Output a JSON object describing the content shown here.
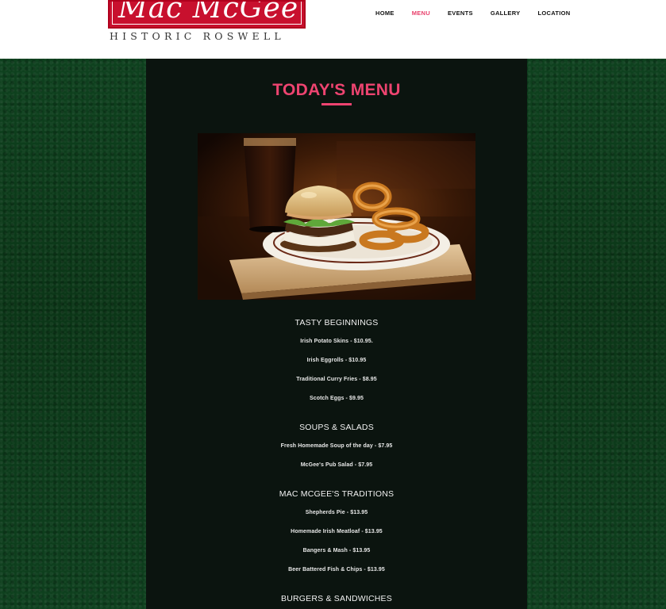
{
  "header": {
    "logo": {
      "name": "Mac McGee",
      "subtitle": "HISTORIC ROSWELL"
    },
    "nav": [
      {
        "label": "HOME",
        "active": false
      },
      {
        "label": "MENU",
        "active": true
      },
      {
        "label": "EVENTS",
        "active": false
      },
      {
        "label": "GALLERY",
        "active": false
      },
      {
        "label": "LOCATION",
        "active": false
      }
    ]
  },
  "main": {
    "title": "TODAY'S MENU",
    "sections": [
      {
        "heading": "TASTY BEGINNINGS",
        "items": [
          "Irish Potato Skins - $10.95.",
          "Irish Eggrolls - $10.95",
          "Traditional Curry Fries - $8.95",
          "Scotch Eggs - $9.95"
        ]
      },
      {
        "heading": "SOUPS & SALADS",
        "items": [
          "Fresh Homemade Soup of the day - $7.95",
          "McGee's Pub Salad - $7.95"
        ]
      },
      {
        "heading": "MAC MCGEE'S TRADITIONS",
        "items": [
          "Shepherds Pie - $13.95",
          "Homemade Irish Meatloaf - $13.95",
          "Bangers & Mash - $13.95",
          "Beer Battered Fish & Chips - $13.95"
        ]
      },
      {
        "heading": "BURGERS & SANDWICHES",
        "items": []
      }
    ]
  },
  "colors": {
    "accent": "#ee4470",
    "brand_red": "#c8102e",
    "content_bg": "#0b140f",
    "page_bg": "#0d3a18"
  }
}
